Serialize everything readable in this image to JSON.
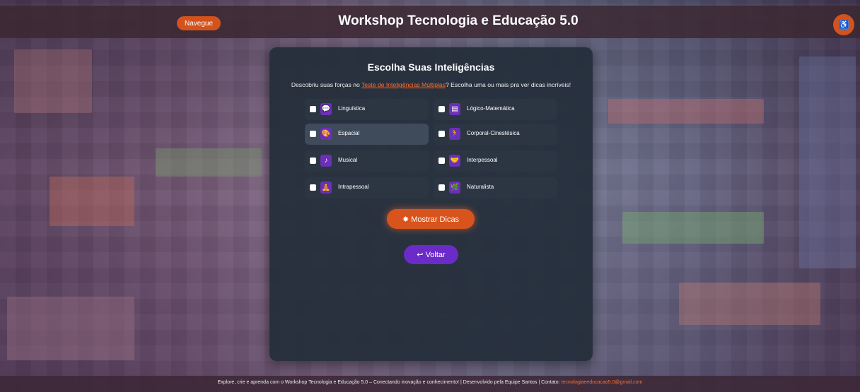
{
  "header": {
    "nav_label": "Navegue",
    "title": "Workshop Tecnologia e Educação 5.0",
    "accessibility_icon": "accessibility-icon"
  },
  "card": {
    "title": "Escolha Suas Inteligências",
    "intro_before": "Descobriu suas forças no ",
    "intro_link": "Teste de Inteligências Múltiplas",
    "intro_after": "? Escolha uma ou mais pra ver dicas incríveis!",
    "options": [
      {
        "label": "Linguística",
        "icon": "speech-bubble-icon",
        "icon_glyph": "💬"
      },
      {
        "label": "Lógico-Matemática",
        "icon": "calculator-icon",
        "icon_glyph": "▤"
      },
      {
        "label": "Espacial",
        "icon": "palette-icon",
        "icon_glyph": "🎨"
      },
      {
        "label": "Corporal-Cinestésica",
        "icon": "running-icon",
        "icon_glyph": "🏃"
      },
      {
        "label": "Musical",
        "icon": "music-icon",
        "icon_glyph": "♪"
      },
      {
        "label": "Interpessoal",
        "icon": "handshake-icon",
        "icon_glyph": "🤝"
      },
      {
        "label": "Intrapessoal",
        "icon": "person-icon",
        "icon_glyph": "🧘"
      },
      {
        "label": "Naturalista",
        "icon": "plant-icon",
        "icon_glyph": "🌿"
      }
    ],
    "show_tips_label": "Mostrar Dicas",
    "show_tips_icon": "✸",
    "back_label": "Voltar",
    "back_icon": "↩"
  },
  "footer": {
    "text": "Explore, crie e aprenda com o Workshop Tecnologia e Educação 5.0 – Conectando inovação e conhecimento! | Desenvolvido pela Equipe Santos | Contato: ",
    "email": "tecnologiaeeducacao5.0@gmail.com"
  },
  "colors": {
    "accent_orange": "#d9541c",
    "accent_purple": "#6a2bc9",
    "card_bg": "#242e3a",
    "link": "#ff6f2b"
  }
}
